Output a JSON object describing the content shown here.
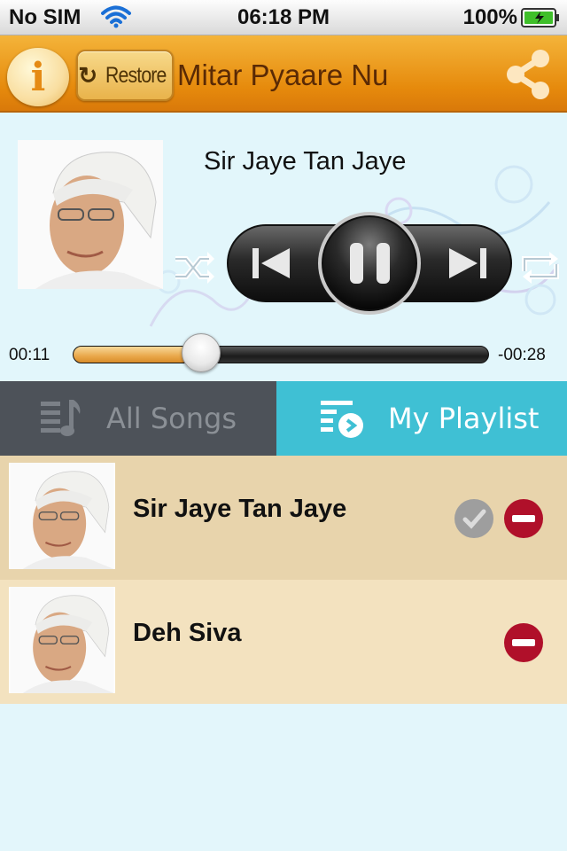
{
  "status_bar": {
    "carrier": "No SIM",
    "time": "06:18 PM",
    "battery": "100%"
  },
  "header": {
    "info_label": "i",
    "restore_label": "Restore",
    "title": "Mitar Pyaare Nu"
  },
  "player": {
    "now_playing_title": "Sir Jaye Tan Jaye",
    "elapsed": "00:11",
    "remaining": "-00:28",
    "progress_fraction": 0.28
  },
  "tabs": {
    "all_songs": "All Songs",
    "my_playlist": "My Playlist",
    "active": "my_playlist"
  },
  "playlist": [
    {
      "title": "Sir Jaye Tan Jaye",
      "playing": true
    },
    {
      "title": "Deh Siva",
      "playing": false
    }
  ],
  "colors": {
    "header_orange": "#e68a0c",
    "tab_active": "#3fc0d4",
    "tab_inactive": "#4d5259",
    "remove_red": "#b0102a"
  }
}
